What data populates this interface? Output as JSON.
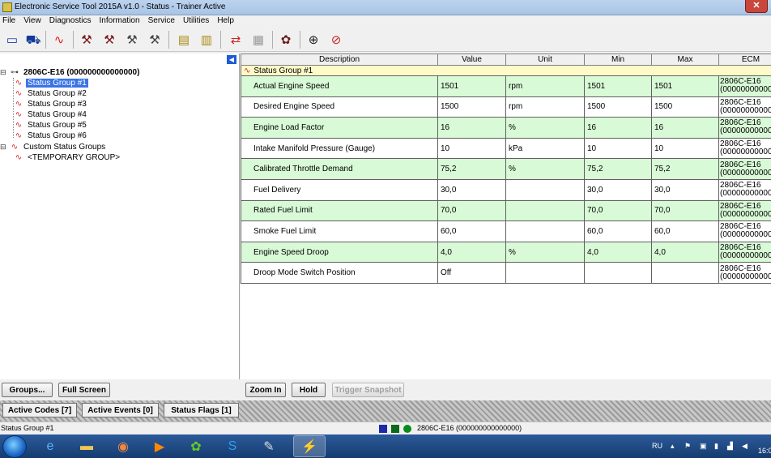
{
  "window": {
    "title": "Electronic Service Tool 2015A v1.0 - Status - Trainer Active",
    "close_glyph": "✕"
  },
  "menu": [
    "File",
    "View",
    "Diagnostics",
    "Information",
    "Service",
    "Utilities",
    "Help"
  ],
  "toolbar_icons": [
    "ecm-summary-icon",
    "connect-icon",
    "status-icon",
    "active-codes-icon",
    "logged-codes-icon",
    "active-events-icon",
    "logged-events-icon",
    "config-icon",
    "flash-icon",
    "calibration-icon",
    "ecm-replace-icon",
    "service-icon",
    "binoculars-icon",
    "disconnect-icon"
  ],
  "tree": {
    "collapse_glyph": "◀",
    "root": "2806C-E16 (000000000000000)",
    "groups": [
      "Status Group #1",
      "Status Group #2",
      "Status Group #3",
      "Status Group #4",
      "Status Group #5",
      "Status Group #6"
    ],
    "custom": "Custom Status Groups",
    "temporary": "<TEMPORARY GROUP>"
  },
  "table": {
    "headers": [
      "Description",
      "Value",
      "Unit",
      "Min",
      "Max",
      "ECM"
    ],
    "group_title": "Status Group #1",
    "rows": [
      {
        "desc": "Actual Engine Speed",
        "value": "1501",
        "unit": "rpm",
        "min": "1501",
        "max": "1501",
        "ecm1": "2806C-E16",
        "ecm2": "(000000000000000"
      },
      {
        "desc": "Desired Engine Speed",
        "value": "1500",
        "unit": "rpm",
        "min": "1500",
        "max": "1500",
        "ecm1": "2806C-E16",
        "ecm2": "(000000000000000"
      },
      {
        "desc": "Engine Load Factor",
        "value": "16",
        "unit": "%",
        "min": "16",
        "max": "16",
        "ecm1": "2806C-E16",
        "ecm2": "(000000000000000"
      },
      {
        "desc": "Intake Manifold Pressure (Gauge)",
        "value": "10",
        "unit": "kPa",
        "min": "10",
        "max": "10",
        "ecm1": "2806C-E16",
        "ecm2": "(000000000000000"
      },
      {
        "desc": "Calibrated Throttle Demand",
        "value": "75,2",
        "unit": "%",
        "min": "75,2",
        "max": "75,2",
        "ecm1": "2806C-E16",
        "ecm2": "(000000000000000"
      },
      {
        "desc": "Fuel Delivery",
        "value": "30,0",
        "unit": "",
        "min": "30,0",
        "max": "30,0",
        "ecm1": "2806C-E16",
        "ecm2": "(000000000000000"
      },
      {
        "desc": "Rated Fuel Limit",
        "value": "70,0",
        "unit": "",
        "min": "70,0",
        "max": "70,0",
        "ecm1": "2806C-E16",
        "ecm2": "(000000000000000"
      },
      {
        "desc": "Smoke Fuel Limit",
        "value": "60,0",
        "unit": "",
        "min": "60,0",
        "max": "60,0",
        "ecm1": "2806C-E16",
        "ecm2": "(000000000000000"
      },
      {
        "desc": "Engine Speed Droop",
        "value": "4,0",
        "unit": "%",
        "min": "4,0",
        "max": "4,0",
        "ecm1": "2806C-E16",
        "ecm2": "(000000000000000"
      },
      {
        "desc": "Droop Mode Switch Position",
        "value": "Off",
        "unit": "",
        "min": "",
        "max": "",
        "ecm1": "2806C-E16",
        "ecm2": "(000000000000000"
      }
    ]
  },
  "buttons": {
    "groups": "Groups...",
    "full_screen": "Full Screen",
    "zoom_in": "Zoom In",
    "hold": "Hold",
    "trigger_snapshot": "Trigger Snapshot"
  },
  "tabs": {
    "active_codes": "Active Codes [7]",
    "active_events": "Active Events [0]",
    "status_flags": "Status Flags [1]"
  },
  "statusbar": {
    "left": "Status Group #1",
    "right": "2806C-E16 (000000000000000)",
    "indicator_colors": [
      "#1a2aa8",
      "#0a6a1a",
      "#0a8a1a"
    ]
  },
  "taskbar": {
    "language": "RU",
    "clock": "16:0"
  },
  "colors": {
    "row_alt": "#d8fad6",
    "group_row": "#fffbc8",
    "selection": "#3a73e6"
  }
}
